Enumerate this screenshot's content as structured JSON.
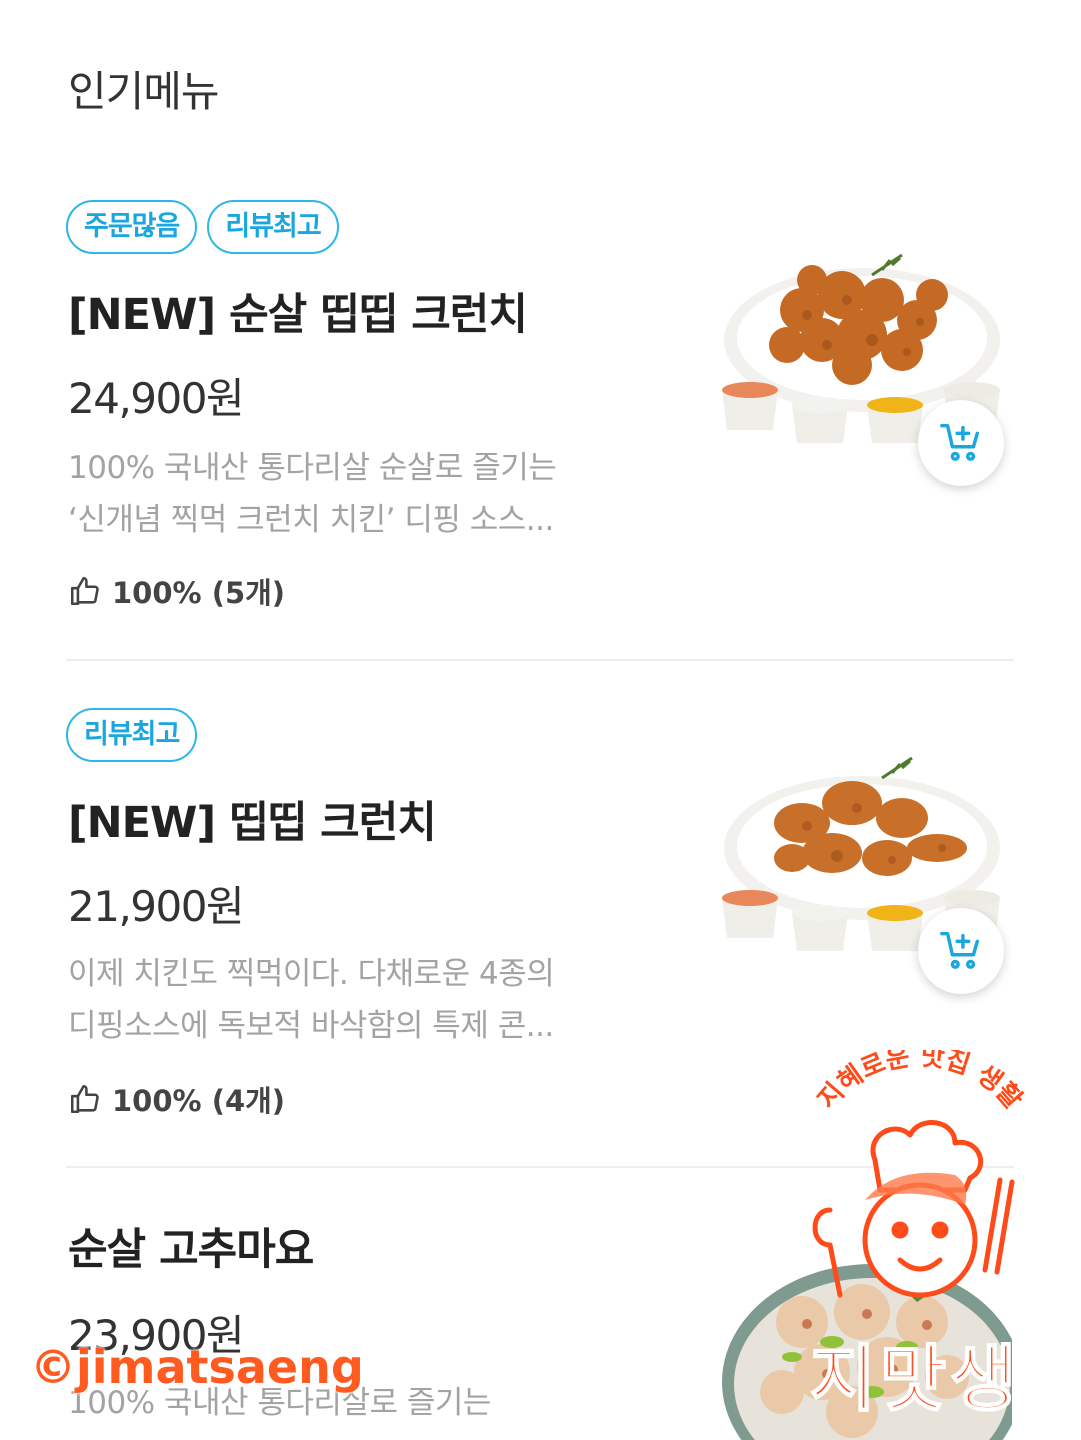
{
  "section_title": "인기메뉴",
  "colors": {
    "tag_accent": "#1aa6de",
    "watermark": "#ff5a1f"
  },
  "items": [
    {
      "tags": [
        "주문많음",
        "리뷰최고"
      ],
      "name": "[NEW] 순살 띱띱 크런치",
      "price": "24,900원",
      "desc_line1": "100% 국내산 통다리살 순살로 즐기는",
      "desc_line2": "‘신개념 찍먹 크런치 치킨’ 디핑 소스...",
      "rating": "100% (5개)",
      "image_icon": "boneless-crunch-chicken-image",
      "cart_icon": "cart-plus-icon"
    },
    {
      "tags": [
        "리뷰최고"
      ],
      "name": "[NEW] 띱띱 크런치",
      "price": "21,900원",
      "desc_line1": "이제 치킨도 찍먹이다. 다채로운 4종의",
      "desc_line2": "디핑소스에 독보적 바삭함의 특제 콘...",
      "rating": "100% (4개)",
      "image_icon": "crunch-chicken-image",
      "cart_icon": "cart-plus-icon"
    },
    {
      "tags": [],
      "name": "순살 고추마요",
      "price": "23,900원",
      "desc_line1": "100% 국내산 통다리살로 즐기는",
      "image_icon": "gochu-mayo-chicken-image"
    }
  ],
  "watermark": {
    "handle": "©jimatsaeng",
    "logo_arc_text": "지혜로운 맛집 생활",
    "logo_letters": "지맛생"
  }
}
